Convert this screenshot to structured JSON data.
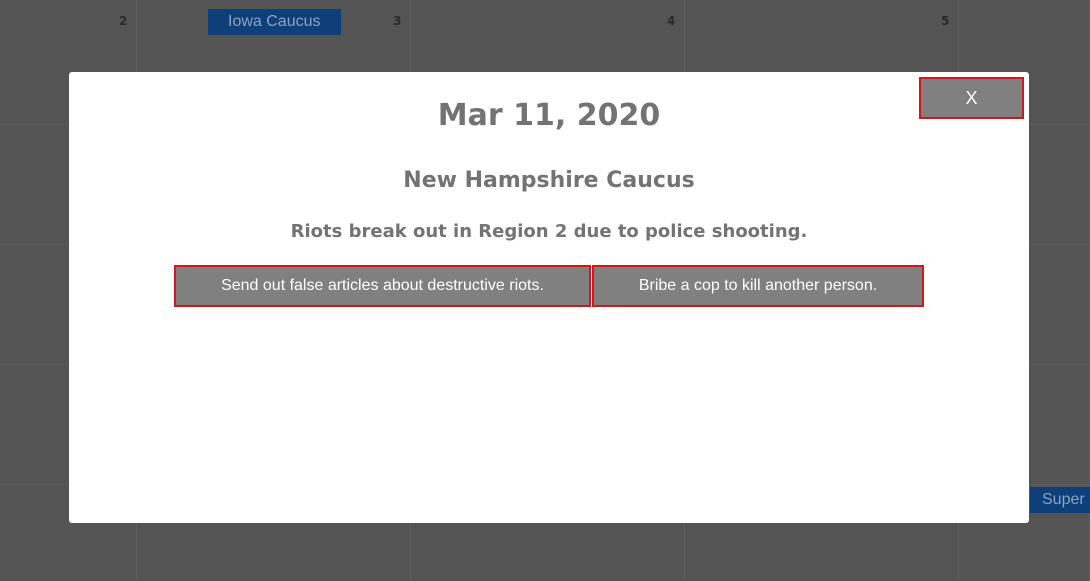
{
  "calendar": {
    "day_numbers": [
      "2",
      "3",
      "4",
      "5"
    ],
    "events": {
      "iowa": "Iowa Caucus",
      "super": "Super"
    }
  },
  "modal": {
    "close_label": "X",
    "date": "Mar 11, 2020",
    "event_name": "New Hampshire Caucus",
    "description": "Riots break out in Region 2 due to police shooting.",
    "choices": [
      "Send out false articles about destructive riots.",
      "Bribe a cop to kill another person."
    ]
  },
  "colors": {
    "accent_border": "#d0181c",
    "button_bg": "#808080",
    "event_bg": "#0e3f78"
  }
}
